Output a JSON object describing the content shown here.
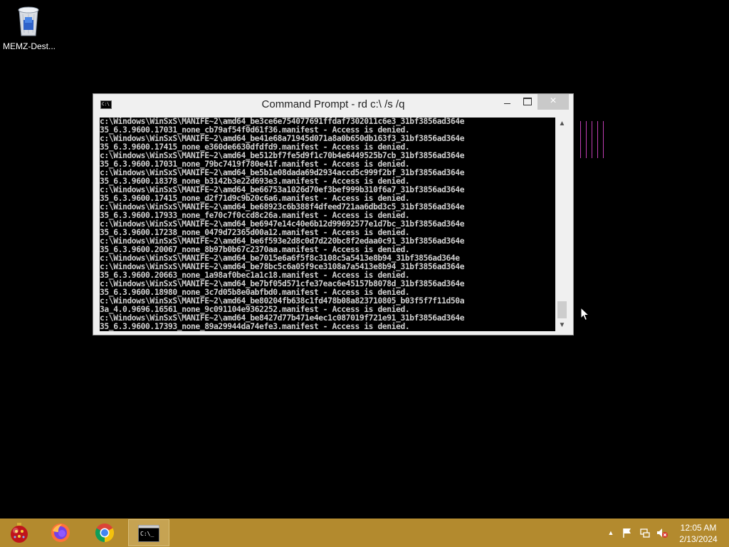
{
  "desktop": {
    "icons": [
      {
        "label": "MEMZ-Dest...",
        "icon": "recycle-bin-icon"
      }
    ]
  },
  "window": {
    "title": "Command Prompt - rd  c:\\ /s /q",
    "controls": {
      "minimize": "minimize",
      "maximize": "maximize",
      "close": "×"
    }
  },
  "console": {
    "lines": [
      "c:\\Windows\\WinSxS\\MANIFE~2\\amd64_be3ce6e754077691ffdaf7302011c6e3_31bf3856ad364e",
      "35_6.3.9600.17031_none_cb79af54f0d61f36.manifest - Access is denied.",
      "c:\\Windows\\WinSxS\\MANIFE~2\\amd64_be41e68a71945d071a8a0b650db163f3_31bf3856ad364e",
      "35_6.3.9600.17415_none_e360de6630dfdfd9.manifest - Access is denied.",
      "c:\\Windows\\WinSxS\\MANIFE~2\\amd64_be512bf7fe5d9f1c70b4e6449525b7cb_31bf3856ad364e",
      "35_6.3.9600.17031_none_79bc7419f780e41f.manifest - Access is denied.",
      "c:\\Windows\\WinSxS\\MANIFE~2\\amd64_be5b1e08dada69d2934accd5c999f2bf_31bf3856ad364e",
      "35_6.3.9600.18378_none_b3142b3e22d693e3.manifest - Access is denied.",
      "c:\\Windows\\WinSxS\\MANIFE~2\\amd64_be66753a1026d70ef3bef999b310f6a7_31bf3856ad364e",
      "35_6.3.9600.17415_none_d2f71d9c9b20c6a6.manifest - Access is denied.",
      "c:\\Windows\\WinSxS\\MANIFE~2\\amd64_be68923c6b388f4dfeed721aa6dbd3c5_31bf3856ad364e",
      "35_6.3.9600.17933_none_fe70c7f0ccd8c26a.manifest - Access is denied.",
      "c:\\Windows\\WinSxS\\MANIFE~2\\amd64_be6947e14c40e6b12d99692577e1d7bc_31bf3856ad364e",
      "35_6.3.9600.17238_none_0479d72365d00a12.manifest - Access is denied.",
      "c:\\Windows\\WinSxS\\MANIFE~2\\amd64_be6f593e2d8c0d7d220bc8f2edaa0c91_31bf3856ad364e",
      "35_6.3.9600.20067_none_8b97b0b67c2370aa.manifest - Access is denied.",
      "c:\\Windows\\WinSxS\\MANIFE~2\\amd64_be7015e6a6f5f8c3108c5a5413e8b94_31bf3856ad364e",
      "c:\\Windows\\WinSxS\\MANIFE~2\\amd64_be78bc5c6a05f9ce3108a7a5413e8b94_31bf3856ad364e",
      "35_6.3.9600.20663_none_1a98af0bec1a1c18.manifest - Access is denied.",
      "c:\\Windows\\WinSxS\\MANIFE~2\\amd64_be7bf05d571cfe37eac6e45157b8078d_31bf3856ad364e",
      "35_6.3.9600.18980_none_3c7d05b8e0abfbd0.manifest - Access is denied.",
      "c:\\Windows\\WinSxS\\MANIFE~2\\amd64_be80204fb638c1fd478b08a823710805_b03f5f7f11d50a",
      "3a_4.0.9696.16561_none_9c091104e9362252.manifest - Access is denied.",
      "c:\\Windows\\WinSxS\\MANIFE~2\\amd64_be8427d77b471e4ec1c087019f721e91_31bf3856ad364e",
      "35_6.3.9600.17393_none_89a29944da74efe3.manifest - Access is denied."
    ]
  },
  "taskbar": {
    "apps": [
      {
        "name": "MEMZ",
        "icon": "memz-ornament-icon"
      },
      {
        "name": "Firefox",
        "icon": "firefox-icon"
      },
      {
        "name": "Chrome",
        "icon": "chrome-icon"
      },
      {
        "name": "Command Prompt",
        "icon": "command-prompt-icon",
        "active": true
      }
    ],
    "tray": {
      "icons": [
        "show-hidden-icons-chevron-icon",
        "action-center-flag-icon",
        "network-icon",
        "volume-muted-icon"
      ],
      "time": "12:05 AM",
      "date": "2/13/2024"
    }
  },
  "colors": {
    "desktop": "#000000",
    "taskbar": "#b38a2e",
    "console_text": "#cfcfcf",
    "glitch_lines": "#c23fb5"
  }
}
